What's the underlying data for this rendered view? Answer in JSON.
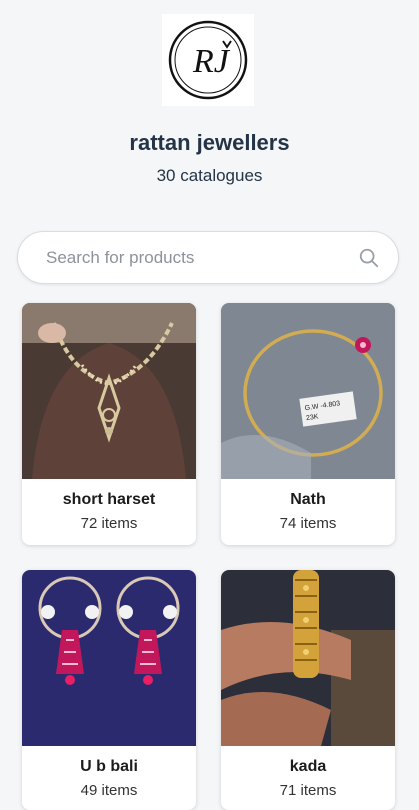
{
  "shop": {
    "logo_text": "RJ",
    "name": "rattan jewellers",
    "catalogue_count": "30 catalogues"
  },
  "search": {
    "placeholder": "Search for products",
    "value": ""
  },
  "catalogues": [
    {
      "name": "short harset",
      "items": "72 items"
    },
    {
      "name": "Nath",
      "items": "74 items"
    },
    {
      "name": "U b bali",
      "items": "49 items"
    },
    {
      "name": "kada",
      "items": "71 items"
    }
  ],
  "photo_details": {
    "tag_text_1": "G.W -4.803",
    "tag_text_2": "23K"
  }
}
